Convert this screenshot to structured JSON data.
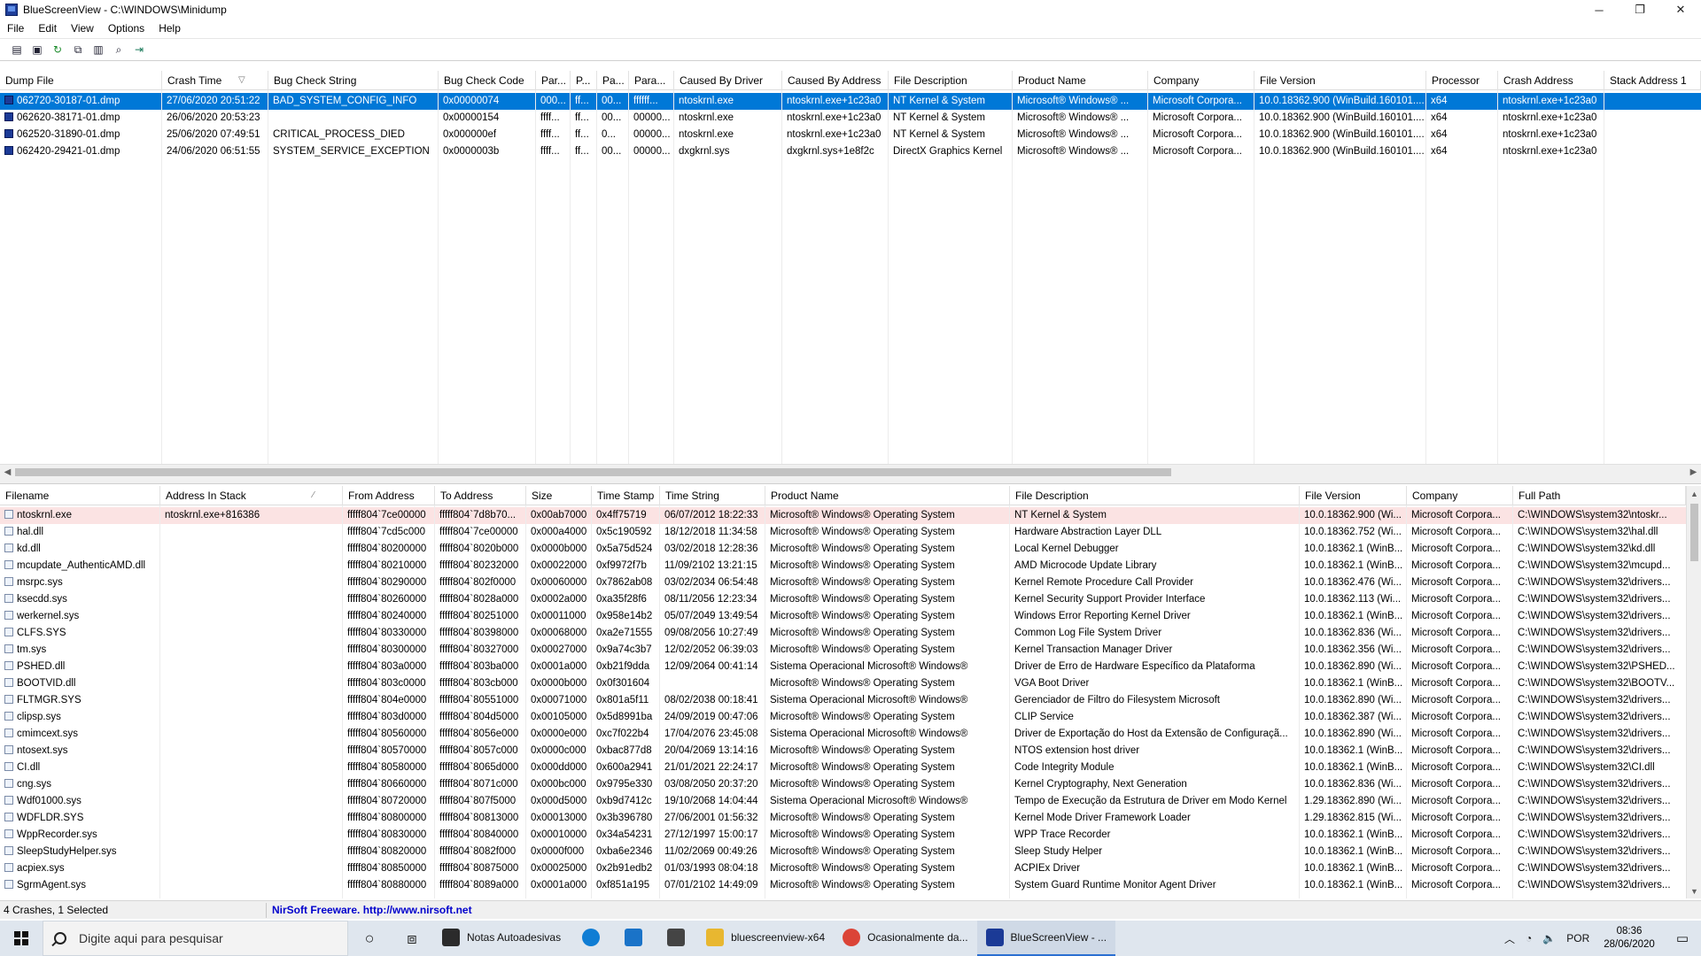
{
  "window": {
    "title": "BlueScreenView  -  C:\\WINDOWS\\Minidump"
  },
  "window_buttons": {
    "minimize": "─",
    "maximize": "❐",
    "close": "✕"
  },
  "menu": [
    "File",
    "Edit",
    "View",
    "Options",
    "Help"
  ],
  "toolbar": [
    "save-html-icon",
    "save-icon",
    "refresh-icon",
    "copy-icon",
    "properties-icon",
    "find-icon",
    "exit-icon"
  ],
  "top_table": {
    "columns": [
      {
        "label": "Dump File",
        "w": 183
      },
      {
        "label": "Crash Time",
        "w": 120,
        "sort": "▽"
      },
      {
        "label": "Bug Check String",
        "w": 192
      },
      {
        "label": "Bug Check Code",
        "w": 110
      },
      {
        "label": "Par...",
        "w": 39
      },
      {
        "label": "P...",
        "w": 30
      },
      {
        "label": "Pa...",
        "w": 36
      },
      {
        "label": "Para...",
        "w": 51
      },
      {
        "label": "Caused By Driver",
        "w": 122
      },
      {
        "label": "Caused By Address",
        "w": 120
      },
      {
        "label": "File Description",
        "w": 140
      },
      {
        "label": "Product Name",
        "w": 153
      },
      {
        "label": "Company",
        "w": 120
      },
      {
        "label": "File Version",
        "w": 194
      },
      {
        "label": "Processor",
        "w": 81
      },
      {
        "label": "Crash Address",
        "w": 120
      },
      {
        "label": "Stack Address 1",
        "w": 109
      }
    ],
    "rows": [
      [
        "062720-30187-01.dmp",
        "27/06/2020 20:51:22",
        "BAD_SYSTEM_CONFIG_INFO",
        "0x00000074",
        "000...",
        "ff...",
        "00...",
        "ffffff...",
        "ntoskrnl.exe",
        "ntoskrnl.exe+1c23a0",
        "NT Kernel & System",
        "Microsoft® Windows® ...",
        "Microsoft Corpora...",
        "10.0.18362.900 (WinBuild.160101....",
        "x64",
        "ntoskrnl.exe+1c23a0",
        ""
      ],
      [
        "062620-38171-01.dmp",
        "26/06/2020 20:53:23",
        "",
        "0x00000154",
        "ffff...",
        "ff...",
        "00...",
        "00000...",
        "ntoskrnl.exe",
        "ntoskrnl.exe+1c23a0",
        "NT Kernel & System",
        "Microsoft® Windows® ...",
        "Microsoft Corpora...",
        "10.0.18362.900 (WinBuild.160101....",
        "x64",
        "ntoskrnl.exe+1c23a0",
        ""
      ],
      [
        "062520-31890-01.dmp",
        "25/06/2020 07:49:51",
        "CRITICAL_PROCESS_DIED",
        "0x000000ef",
        "ffff...",
        "ff...",
        "0...",
        "00000...",
        "ntoskrnl.exe",
        "ntoskrnl.exe+1c23a0",
        "NT Kernel & System",
        "Microsoft® Windows® ...",
        "Microsoft Corpora...",
        "10.0.18362.900 (WinBuild.160101....",
        "x64",
        "ntoskrnl.exe+1c23a0",
        ""
      ],
      [
        "062420-29421-01.dmp",
        "24/06/2020 06:51:55",
        "SYSTEM_SERVICE_EXCEPTION",
        "0x0000003b",
        "ffff...",
        "ff...",
        "00...",
        "00000...",
        "dxgkrnl.sys",
        "dxgkrnl.sys+1e8f2c",
        "DirectX Graphics Kernel",
        "Microsoft® Windows® ...",
        "Microsoft Corpora...",
        "10.0.18362.900 (WinBuild.160101....",
        "x64",
        "ntoskrnl.exe+1c23a0",
        ""
      ]
    ],
    "selected_row": 0
  },
  "bottom_table": {
    "columns": [
      {
        "label": "Filename",
        "w": 181
      },
      {
        "label": "Address In Stack",
        "w": 206,
        "sort": "⁄"
      },
      {
        "label": "From Address",
        "w": 104
      },
      {
        "label": "To Address",
        "w": 103
      },
      {
        "label": "Size",
        "w": 74
      },
      {
        "label": "Time Stamp",
        "w": 77
      },
      {
        "label": "Time String",
        "w": 119
      },
      {
        "label": "Product Name",
        "w": 276
      },
      {
        "label": "File Description",
        "w": 327
      },
      {
        "label": "File Version",
        "w": 121
      },
      {
        "label": "Company",
        "w": 120
      },
      {
        "label": "Full Path",
        "w": 195
      }
    ],
    "rows": [
      [
        "ntoskrnl.exe",
        "ntoskrnl.exe+816386",
        "fffff804`7ce00000",
        "fffff804`7d8b70...",
        "0x00ab7000",
        "0x4ff75719",
        "06/07/2012 18:22:33",
        "Microsoft® Windows® Operating System",
        "NT Kernel & System",
        "10.0.18362.900 (Wi...",
        "Microsoft Corpora...",
        "C:\\WINDOWS\\system32\\ntoskr..."
      ],
      [
        "hal.dll",
        "",
        "fffff804`7cd5c000",
        "fffff804`7ce00000",
        "0x000a4000",
        "0x5c190592",
        "18/12/2018 11:34:58",
        "Microsoft® Windows® Operating System",
        "Hardware Abstraction Layer DLL",
        "10.0.18362.752 (Wi...",
        "Microsoft Corpora...",
        "C:\\WINDOWS\\system32\\hal.dll"
      ],
      [
        "kd.dll",
        "",
        "fffff804`80200000",
        "fffff804`8020b000",
        "0x0000b000",
        "0x5a75d524",
        "03/02/2018 12:28:36",
        "Microsoft® Windows® Operating System",
        "Local Kernel Debugger",
        "10.0.18362.1 (WinB...",
        "Microsoft Corpora...",
        "C:\\WINDOWS\\system32\\kd.dll"
      ],
      [
        "mcupdate_AuthenticAMD.dll",
        "",
        "fffff804`80210000",
        "fffff804`80232000",
        "0x00022000",
        "0xf9972f7b",
        "11/09/2102 13:21:15",
        "Microsoft® Windows® Operating System",
        "AMD Microcode Update Library",
        "10.0.18362.1 (WinB...",
        "Microsoft Corpora...",
        "C:\\WINDOWS\\system32\\mcupd..."
      ],
      [
        "msrpc.sys",
        "",
        "fffff804`80290000",
        "fffff804`802f0000",
        "0x00060000",
        "0x7862ab08",
        "03/02/2034 06:54:48",
        "Microsoft® Windows® Operating System",
        "Kernel Remote Procedure Call Provider",
        "10.0.18362.476 (Wi...",
        "Microsoft Corpora...",
        "C:\\WINDOWS\\system32\\drivers..."
      ],
      [
        "ksecdd.sys",
        "",
        "fffff804`80260000",
        "fffff804`8028a000",
        "0x0002a000",
        "0xa35f28f6",
        "08/11/2056 12:23:34",
        "Microsoft® Windows® Operating System",
        "Kernel Security Support Provider Interface",
        "10.0.18362.113 (Wi...",
        "Microsoft Corpora...",
        "C:\\WINDOWS\\system32\\drivers..."
      ],
      [
        "werkernel.sys",
        "",
        "fffff804`80240000",
        "fffff804`80251000",
        "0x00011000",
        "0x958e14b2",
        "05/07/2049 13:49:54",
        "Microsoft® Windows® Operating System",
        "Windows Error Reporting Kernel Driver",
        "10.0.18362.1 (WinB...",
        "Microsoft Corpora...",
        "C:\\WINDOWS\\system32\\drivers..."
      ],
      [
        "CLFS.SYS",
        "",
        "fffff804`80330000",
        "fffff804`80398000",
        "0x00068000",
        "0xa2e71555",
        "09/08/2056 10:27:49",
        "Microsoft® Windows® Operating System",
        "Common Log File System Driver",
        "10.0.18362.836 (Wi...",
        "Microsoft Corpora...",
        "C:\\WINDOWS\\system32\\drivers..."
      ],
      [
        "tm.sys",
        "",
        "fffff804`80300000",
        "fffff804`80327000",
        "0x00027000",
        "0x9a74c3b7",
        "12/02/2052 06:39:03",
        "Microsoft® Windows® Operating System",
        "Kernel Transaction Manager Driver",
        "10.0.18362.356 (Wi...",
        "Microsoft Corpora...",
        "C:\\WINDOWS\\system32\\drivers..."
      ],
      [
        "PSHED.dll",
        "",
        "fffff804`803a0000",
        "fffff804`803ba000",
        "0x0001a000",
        "0xb21f9dda",
        "12/09/2064 00:41:14",
        "Sistema Operacional Microsoft® Windows®",
        "Driver de Erro de Hardware Específico da Plataforma",
        "10.0.18362.890 (Wi...",
        "Microsoft Corpora...",
        "C:\\WINDOWS\\system32\\PSHED..."
      ],
      [
        "BOOTVID.dll",
        "",
        "fffff804`803c0000",
        "fffff804`803cb000",
        "0x0000b000",
        "0x0f301604",
        "",
        "Microsoft® Windows® Operating System",
        "VGA Boot Driver",
        "10.0.18362.1 (WinB...",
        "Microsoft Corpora...",
        "C:\\WINDOWS\\system32\\BOOTV..."
      ],
      [
        "FLTMGR.SYS",
        "",
        "fffff804`804e0000",
        "fffff804`80551000",
        "0x00071000",
        "0x801a5f11",
        "08/02/2038 00:18:41",
        "Sistema Operacional Microsoft® Windows®",
        "Gerenciador de Filtro do Filesystem Microsoft",
        "10.0.18362.890 (Wi...",
        "Microsoft Corpora...",
        "C:\\WINDOWS\\system32\\drivers..."
      ],
      [
        "clipsp.sys",
        "",
        "fffff804`803d0000",
        "fffff804`804d5000",
        "0x00105000",
        "0x5d8991ba",
        "24/09/2019 00:47:06",
        "Microsoft® Windows® Operating System",
        "CLIP Service",
        "10.0.18362.387 (Wi...",
        "Microsoft Corpora...",
        "C:\\WINDOWS\\system32\\drivers..."
      ],
      [
        "cmimcext.sys",
        "",
        "fffff804`80560000",
        "fffff804`8056e000",
        "0x0000e000",
        "0xc7f022b4",
        "17/04/2076 23:45:08",
        "Sistema Operacional Microsoft® Windows®",
        "Driver de Exportação do Host da Extensão de Configuraçã...",
        "10.0.18362.890 (Wi...",
        "Microsoft Corpora...",
        "C:\\WINDOWS\\system32\\drivers..."
      ],
      [
        "ntosext.sys",
        "",
        "fffff804`80570000",
        "fffff804`8057c000",
        "0x0000c000",
        "0xbac877d8",
        "20/04/2069 13:14:16",
        "Microsoft® Windows® Operating System",
        "NTOS extension host driver",
        "10.0.18362.1 (WinB...",
        "Microsoft Corpora...",
        "C:\\WINDOWS\\system32\\drivers..."
      ],
      [
        "CI.dll",
        "",
        "fffff804`80580000",
        "fffff804`8065d000",
        "0x000dd000",
        "0x600a2941",
        "21/01/2021 22:24:17",
        "Microsoft® Windows® Operating System",
        "Code Integrity Module",
        "10.0.18362.1 (WinB...",
        "Microsoft Corpora...",
        "C:\\WINDOWS\\system32\\CI.dll"
      ],
      [
        "cng.sys",
        "",
        "fffff804`80660000",
        "fffff804`8071c000",
        "0x000bc000",
        "0x9795e330",
        "03/08/2050 20:37:20",
        "Microsoft® Windows® Operating System",
        "Kernel Cryptography, Next Generation",
        "10.0.18362.836 (Wi...",
        "Microsoft Corpora...",
        "C:\\WINDOWS\\system32\\drivers..."
      ],
      [
        "Wdf01000.sys",
        "",
        "fffff804`80720000",
        "fffff804`807f5000",
        "0x000d5000",
        "0xb9d7412c",
        "19/10/2068 14:04:44",
        "Sistema Operacional Microsoft® Windows®",
        "Tempo de Execução da Estrutura de Driver em Modo Kernel",
        "1.29.18362.890 (Wi...",
        "Microsoft Corpora...",
        "C:\\WINDOWS\\system32\\drivers..."
      ],
      [
        "WDFLDR.SYS",
        "",
        "fffff804`80800000",
        "fffff804`80813000",
        "0x00013000",
        "0x3b396780",
        "27/06/2001 01:56:32",
        "Microsoft® Windows® Operating System",
        "Kernel Mode Driver Framework Loader",
        "1.29.18362.815 (Wi...",
        "Microsoft Corpora...",
        "C:\\WINDOWS\\system32\\drivers..."
      ],
      [
        "WppRecorder.sys",
        "",
        "fffff804`80830000",
        "fffff804`80840000",
        "0x00010000",
        "0x34a54231",
        "27/12/1997 15:00:17",
        "Microsoft® Windows® Operating System",
        "WPP Trace Recorder",
        "10.0.18362.1 (WinB...",
        "Microsoft Corpora...",
        "C:\\WINDOWS\\system32\\drivers..."
      ],
      [
        "SleepStudyHelper.sys",
        "",
        "fffff804`80820000",
        "fffff804`8082f000",
        "0x0000f000",
        "0xba6e2346",
        "11/02/2069 00:49:26",
        "Microsoft® Windows® Operating System",
        "Sleep Study Helper",
        "10.0.18362.1 (WinB...",
        "Microsoft Corpora...",
        "C:\\WINDOWS\\system32\\drivers..."
      ],
      [
        "acpiex.sys",
        "",
        "fffff804`80850000",
        "fffff804`80875000",
        "0x00025000",
        "0x2b91edb2",
        "01/03/1993 08:04:18",
        "Microsoft® Windows® Operating System",
        "ACPIEx Driver",
        "10.0.18362.1 (WinB...",
        "Microsoft Corpora...",
        "C:\\WINDOWS\\system32\\drivers..."
      ],
      [
        "SgrmAgent.sys",
        "",
        "fffff804`80880000",
        "fffff804`8089a000",
        "0x0001a000",
        "0xf851a195",
        "07/01/2102 14:49:09",
        "Microsoft® Windows® Operating System",
        "System Guard Runtime Monitor Agent Driver",
        "10.0.18362.1 (WinB...",
        "Microsoft Corpora...",
        "C:\\WINDOWS\\system32\\drivers..."
      ]
    ],
    "highlight_row": 0
  },
  "status": {
    "count": "4 Crashes, 1 Selected",
    "nirsoft": "NirSoft Freeware.  http://www.nirsoft.net"
  },
  "taskbar": {
    "search_placeholder": "Digite aqui para pesquisar",
    "apps": [
      {
        "label": "Notas Autoadesivas",
        "icon": "sticky-notes-icon",
        "color": "#2b2b2b",
        "active": false
      },
      {
        "label": "",
        "icon": "edge-icon",
        "color": "#0f7dd4",
        "active": false
      },
      {
        "label": "",
        "icon": "mail-icon",
        "color": "#1a73c8",
        "active": false
      },
      {
        "label": "",
        "icon": "alarm-icon",
        "color": "#444444",
        "active": false
      },
      {
        "label": "bluescreenview-x64",
        "icon": "folder-icon",
        "color": "#e8b730",
        "active": false
      },
      {
        "label": "Ocasionalmente da...",
        "icon": "chrome-icon",
        "color": "#db4437",
        "active": false
      },
      {
        "label": "BlueScreenView - ...",
        "icon": "bluescreenview-icon",
        "color": "#1b3a96",
        "active": true
      }
    ],
    "tray": {
      "lang": "POR",
      "time": "08:36",
      "date": "28/06/2020"
    }
  }
}
